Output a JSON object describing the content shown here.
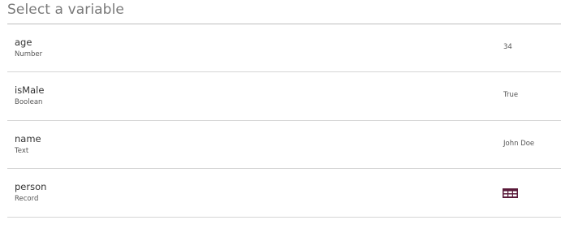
{
  "header": {
    "title": "Select a variable"
  },
  "variables": [
    {
      "name": "age",
      "type": "Number",
      "value": "34"
    },
    {
      "name": "isMale",
      "type": "Boolean",
      "value": "True"
    },
    {
      "name": "name",
      "type": "Text",
      "value": "John Doe"
    },
    {
      "name": "person",
      "type": "Record",
      "value_icon": "table-icon",
      "icon_color": "#5a1a3a"
    }
  ]
}
